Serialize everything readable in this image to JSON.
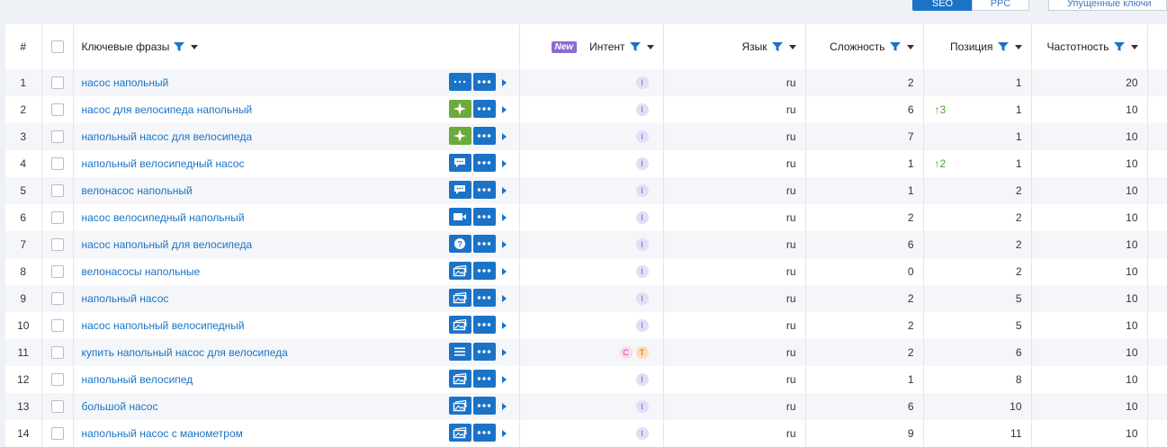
{
  "top_tabs": {
    "seo": "SEO",
    "ppc": "PPC",
    "missed": "Упущенные ключи"
  },
  "table": {
    "headers": {
      "num": "#",
      "keyword": "Ключевые фразы",
      "new_badge": "New",
      "intent": "Интент",
      "language": "Язык",
      "difficulty": "Сложность",
      "position": "Позиция",
      "frequency": "Частотность"
    },
    "rows": [
      {
        "n": "1",
        "kw": "насос напольный",
        "serp": "dots-icon",
        "intents": [
          "I"
        ],
        "lang": "ru",
        "kd": "2",
        "delta": "",
        "pos": "1",
        "freq": "20"
      },
      {
        "n": "2",
        "kw": "насос для велосипеда напольный",
        "serp": "sparkle-icon",
        "intents": [
          "I"
        ],
        "lang": "ru",
        "kd": "6",
        "delta": "3",
        "pos": "1",
        "freq": "10"
      },
      {
        "n": "3",
        "kw": "напольный насос для велосипеда",
        "serp": "sparkle-icon",
        "intents": [
          "I"
        ],
        "lang": "ru",
        "kd": "7",
        "delta": "",
        "pos": "1",
        "freq": "10"
      },
      {
        "n": "4",
        "kw": "напольный велосипедный насос",
        "serp": "chat-icon",
        "intents": [
          "I"
        ],
        "lang": "ru",
        "kd": "1",
        "delta": "2",
        "pos": "1",
        "freq": "10"
      },
      {
        "n": "5",
        "kw": "велонасос напольный",
        "serp": "chat-icon",
        "intents": [
          "I"
        ],
        "lang": "ru",
        "kd": "1",
        "delta": "",
        "pos": "2",
        "freq": "10"
      },
      {
        "n": "6",
        "kw": "насос велосипедный напольный",
        "serp": "video-icon",
        "intents": [
          "I"
        ],
        "lang": "ru",
        "kd": "2",
        "delta": "",
        "pos": "2",
        "freq": "10"
      },
      {
        "n": "7",
        "kw": "насос напольный для велосипеда",
        "serp": "question-icon",
        "intents": [
          "I"
        ],
        "lang": "ru",
        "kd": "6",
        "delta": "",
        "pos": "2",
        "freq": "10"
      },
      {
        "n": "8",
        "kw": "велонасосы напольные",
        "serp": "images-icon",
        "intents": [
          "I"
        ],
        "lang": "ru",
        "kd": "0",
        "delta": "",
        "pos": "2",
        "freq": "10"
      },
      {
        "n": "9",
        "kw": "напольный насос",
        "serp": "images-icon",
        "intents": [
          "I"
        ],
        "lang": "ru",
        "kd": "2",
        "delta": "",
        "pos": "5",
        "freq": "10"
      },
      {
        "n": "10",
        "kw": "насос напольный велосипедный",
        "serp": "images-icon",
        "intents": [
          "I"
        ],
        "lang": "ru",
        "kd": "2",
        "delta": "",
        "pos": "5",
        "freq": "10"
      },
      {
        "n": "11",
        "kw": "купить напольный насос для велосипеда",
        "serp": "list-icon",
        "intents": [
          "C",
          "T"
        ],
        "lang": "ru",
        "kd": "2",
        "delta": "",
        "pos": "6",
        "freq": "10"
      },
      {
        "n": "12",
        "kw": "напольный велосипед",
        "serp": "images-icon",
        "intents": [
          "I"
        ],
        "lang": "ru",
        "kd": "1",
        "delta": "",
        "pos": "8",
        "freq": "10"
      },
      {
        "n": "13",
        "kw": "большой насос",
        "serp": "images-icon",
        "intents": [
          "I"
        ],
        "lang": "ru",
        "kd": "6",
        "delta": "",
        "pos": "10",
        "freq": "10"
      },
      {
        "n": "14",
        "kw": "напольный насос с манометром",
        "serp": "images-icon",
        "intents": [
          "I"
        ],
        "lang": "ru",
        "kd": "9",
        "delta": "",
        "pos": "11",
        "freq": "10"
      }
    ]
  },
  "colors": {
    "accent": "#1a73c7",
    "green": "#6aab3c",
    "up": "#4aa33a"
  }
}
